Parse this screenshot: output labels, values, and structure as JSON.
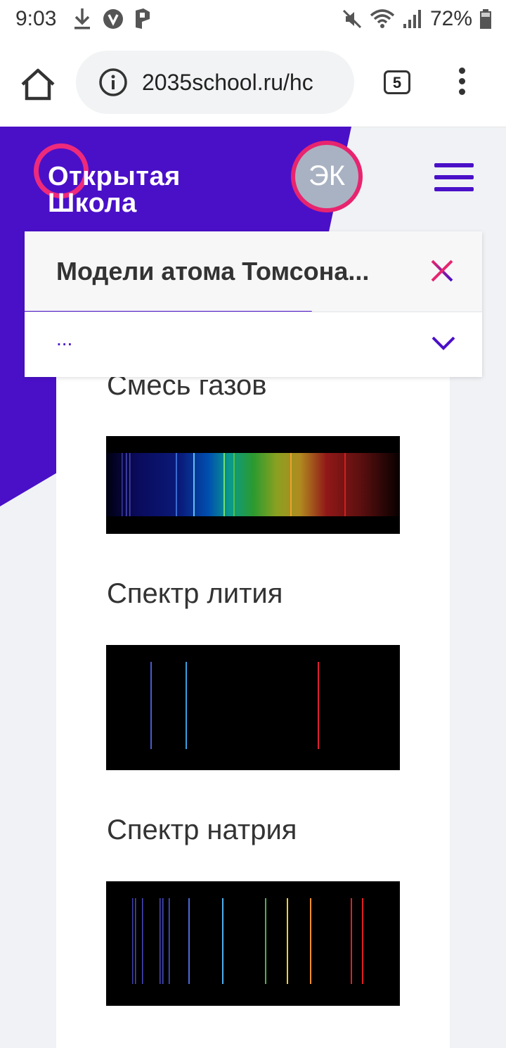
{
  "status_bar": {
    "time": "9:03",
    "battery": "72%",
    "icons": [
      "download-icon",
      "v-app-icon",
      "p-app-icon",
      "mute-icon",
      "wifi-icon",
      "signal-icon",
      "battery-icon"
    ]
  },
  "browser": {
    "url": "2035school.ru/hc",
    "tab_count": "5",
    "icons": [
      "home-icon",
      "info-icon",
      "more-icon"
    ]
  },
  "header": {
    "logo_line1": "Открытая",
    "logo_line2": "Школа",
    "avatar_initials": "ЭК",
    "colors": {
      "purple": "#4a10c8",
      "pink": "#e8246e",
      "avatar_bg": "#a9b2c2"
    }
  },
  "lesson_panel": {
    "title": "Модели атома Томсона...",
    "section": "..."
  },
  "content": {
    "spectra": [
      {
        "label": "Смесь газов"
      },
      {
        "label": "Спектр лития"
      },
      {
        "label": "Спектр натрия"
      }
    ]
  }
}
